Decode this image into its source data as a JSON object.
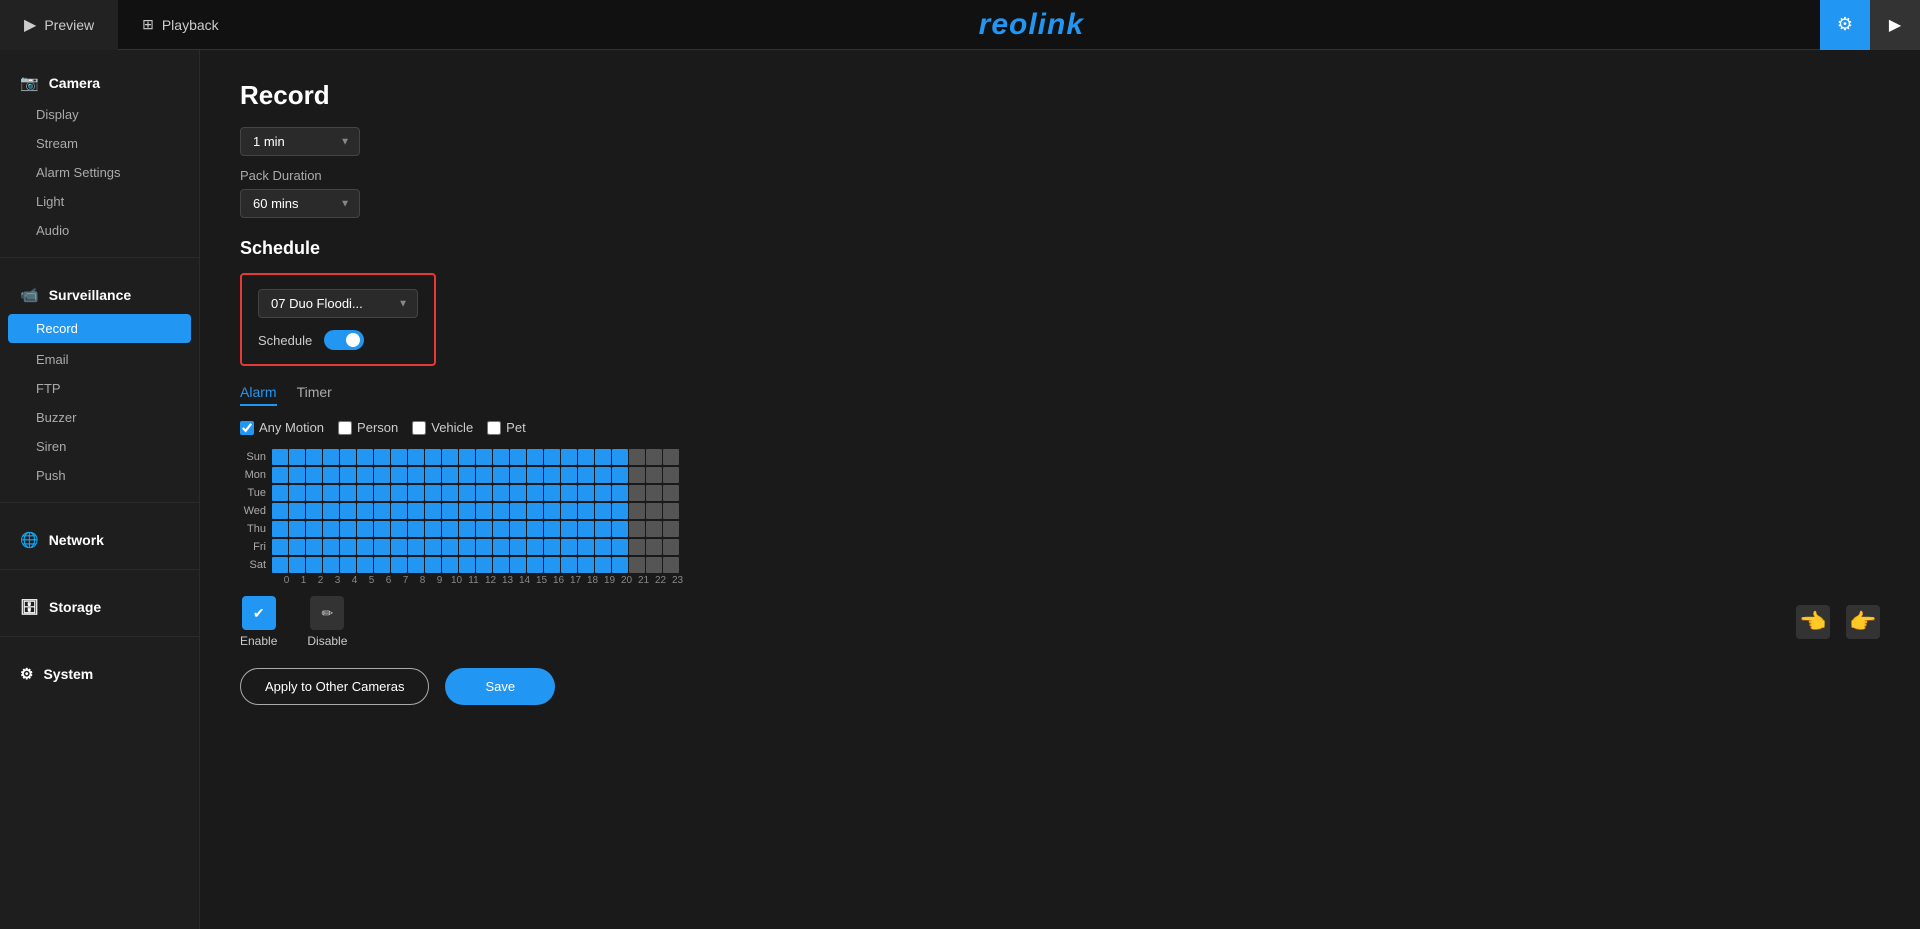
{
  "app": {
    "logo": "reolink",
    "accent_color": "#2196f3"
  },
  "topnav": {
    "preview_label": "Preview",
    "playback_label": "Playback",
    "preview_icon": "▶",
    "playback_icon": "⊞"
  },
  "sidebar": {
    "camera_section": "Camera",
    "camera_items": [
      "Display",
      "Stream",
      "Alarm Settings",
      "Light",
      "Audio"
    ],
    "surveillance_section": "Surveillance",
    "surveillance_items": [
      "Record",
      "Email",
      "FTP",
      "Buzzer",
      "Siren",
      "Push"
    ],
    "network_section": "Network",
    "storage_section": "Storage",
    "system_section": "System"
  },
  "main": {
    "page_title": "Record",
    "duration_value": "1 min",
    "pack_duration_label": "Pack Duration",
    "pack_duration_value": "60 mins",
    "schedule_title": "Schedule",
    "camera_select_value": "07  Duo Floodi...",
    "schedule_label": "Schedule",
    "schedule_enabled": true,
    "tabs": [
      "Alarm",
      "Timer"
    ],
    "active_tab": "Alarm",
    "checkboxes": [
      {
        "label": "Any Motion",
        "checked": true
      },
      {
        "label": "Person",
        "checked": false
      },
      {
        "label": "Vehicle",
        "checked": false
      },
      {
        "label": "Pet",
        "checked": false
      }
    ],
    "days": [
      "Sun",
      "Mon",
      "Tue",
      "Wed",
      "Thu",
      "Fri",
      "Sat"
    ],
    "time_labels": [
      "0",
      "1",
      "2",
      "3",
      "4",
      "5",
      "6",
      "7",
      "8",
      "9",
      "10",
      "11",
      "12",
      "13",
      "14",
      "15",
      "16",
      "17",
      "18",
      "19",
      "20",
      "21",
      "22",
      "23"
    ],
    "grid_inactive_cols": [
      21,
      22,
      23
    ],
    "actions": {
      "enable_label": "Enable",
      "disable_label": "Disable"
    },
    "apply_btn": "Apply to Other Cameras",
    "save_btn": "Save"
  }
}
